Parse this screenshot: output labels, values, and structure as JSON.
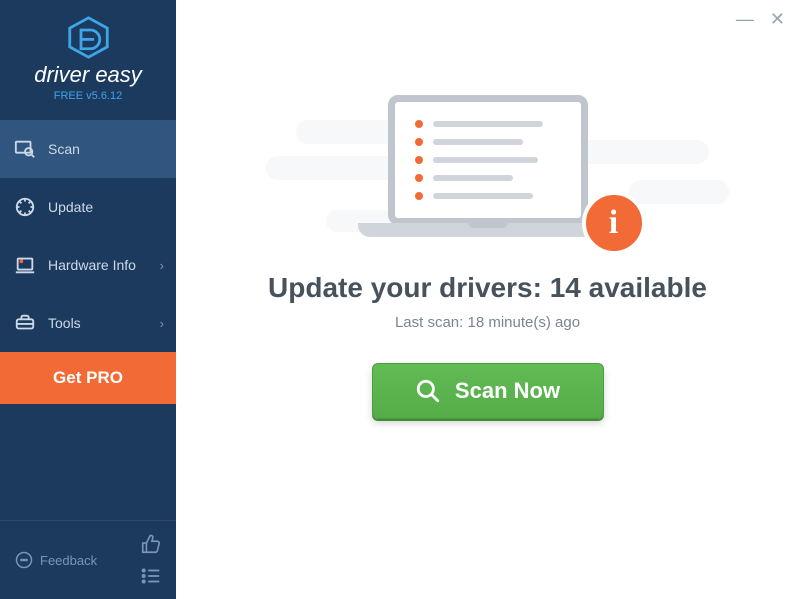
{
  "app": {
    "name": "driver easy",
    "version_label": "FREE v5.6.12"
  },
  "sidebar": {
    "items": [
      {
        "label": "Scan",
        "has_chevron": false
      },
      {
        "label": "Update",
        "has_chevron": false
      },
      {
        "label": "Hardware Info",
        "has_chevron": true
      },
      {
        "label": "Tools",
        "has_chevron": true
      }
    ],
    "get_pro_label": "Get PRO",
    "feedback_label": "Feedback"
  },
  "main": {
    "headline_prefix": "Update your drivers: ",
    "available_count": "14",
    "headline_suffix": " available",
    "last_scan_text": "Last scan: 18 minute(s) ago",
    "scan_button_label": "Scan Now"
  },
  "colors": {
    "accent_orange": "#f26a35",
    "sidebar_bg": "#1c3a5e",
    "green": "#5fb852"
  }
}
